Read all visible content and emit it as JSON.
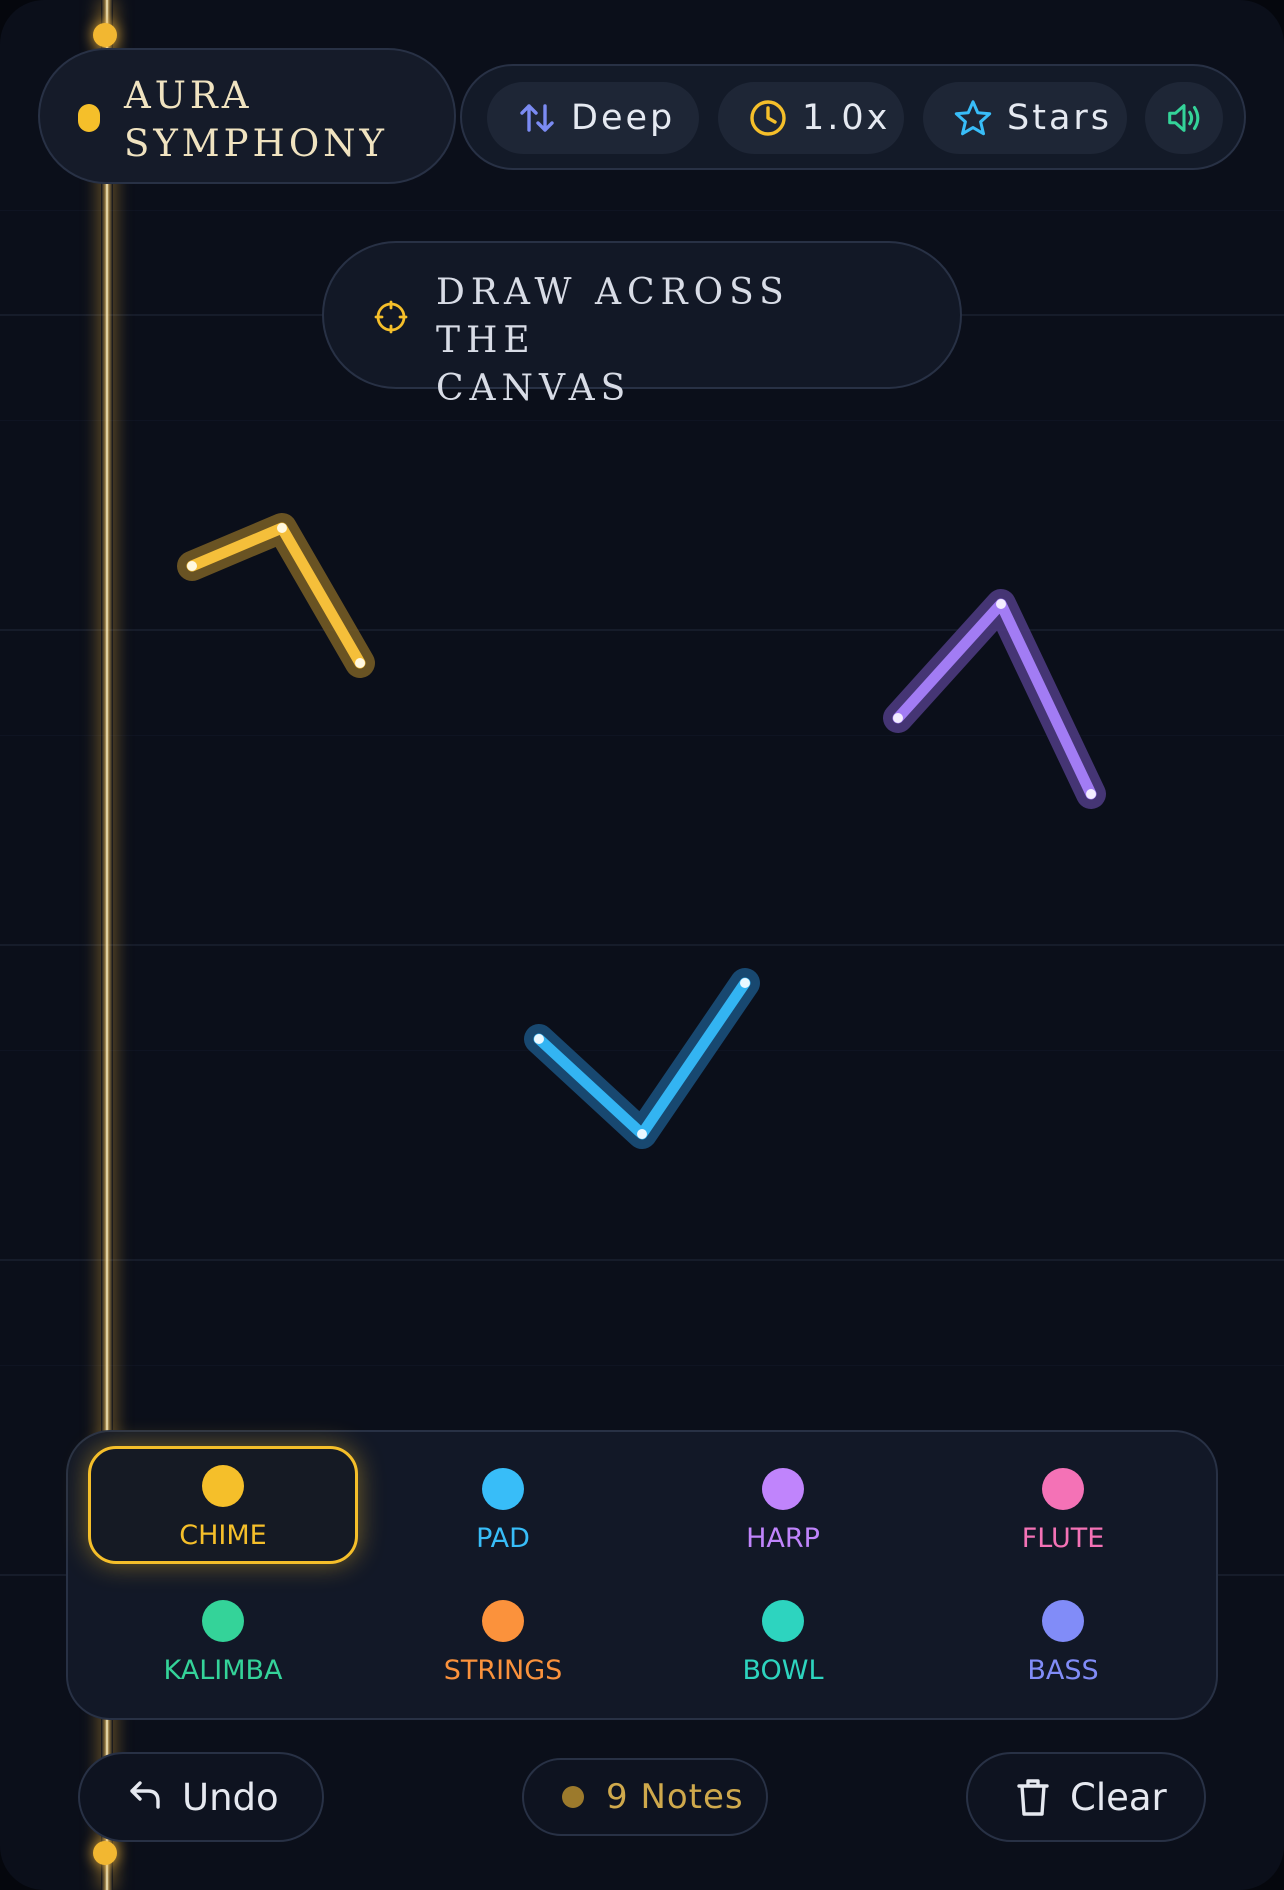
{
  "app": {
    "title_line1": "AURA",
    "title_line2": "SYMPHONY",
    "accent": "#f5bf2a"
  },
  "toolbar": {
    "scale_label": "Deep",
    "scale_icon": "sort-arrows-icon",
    "speed_label": "1.0x",
    "speed_icon": "clock-icon",
    "theme_label": "Stars",
    "theme_icon": "star-icon",
    "sound_icon": "speaker-on-icon"
  },
  "hint": {
    "line1": "DRAW ACROSS THE",
    "line2": "CANVAS",
    "icon": "crosshair-icon"
  },
  "strokes": [
    {
      "instrument": "CHIME",
      "color": "#f5bf3a"
    },
    {
      "instrument": "HARP",
      "color": "#a27cf4"
    },
    {
      "instrument": "PAD",
      "color": "#33b4f2"
    }
  ],
  "instruments": {
    "selected": "CHIME",
    "items": [
      {
        "name": "CHIME",
        "color": "#f5bf2a"
      },
      {
        "name": "PAD",
        "color": "#38bdf8"
      },
      {
        "name": "HARP",
        "color": "#c084fc"
      },
      {
        "name": "FLUTE",
        "color": "#f472b6"
      },
      {
        "name": "KALIMBA",
        "color": "#34d399"
      },
      {
        "name": "STRINGS",
        "color": "#fb923c"
      },
      {
        "name": "BOWL",
        "color": "#2dd4bf"
      },
      {
        "name": "BASS",
        "color": "#818cf8"
      }
    ]
  },
  "controls": {
    "undo_label": "Undo",
    "undo_icon": "undo-arrow-icon",
    "notes_label": "9 Notes",
    "clear_label": "Clear",
    "clear_icon": "trash-icon"
  }
}
